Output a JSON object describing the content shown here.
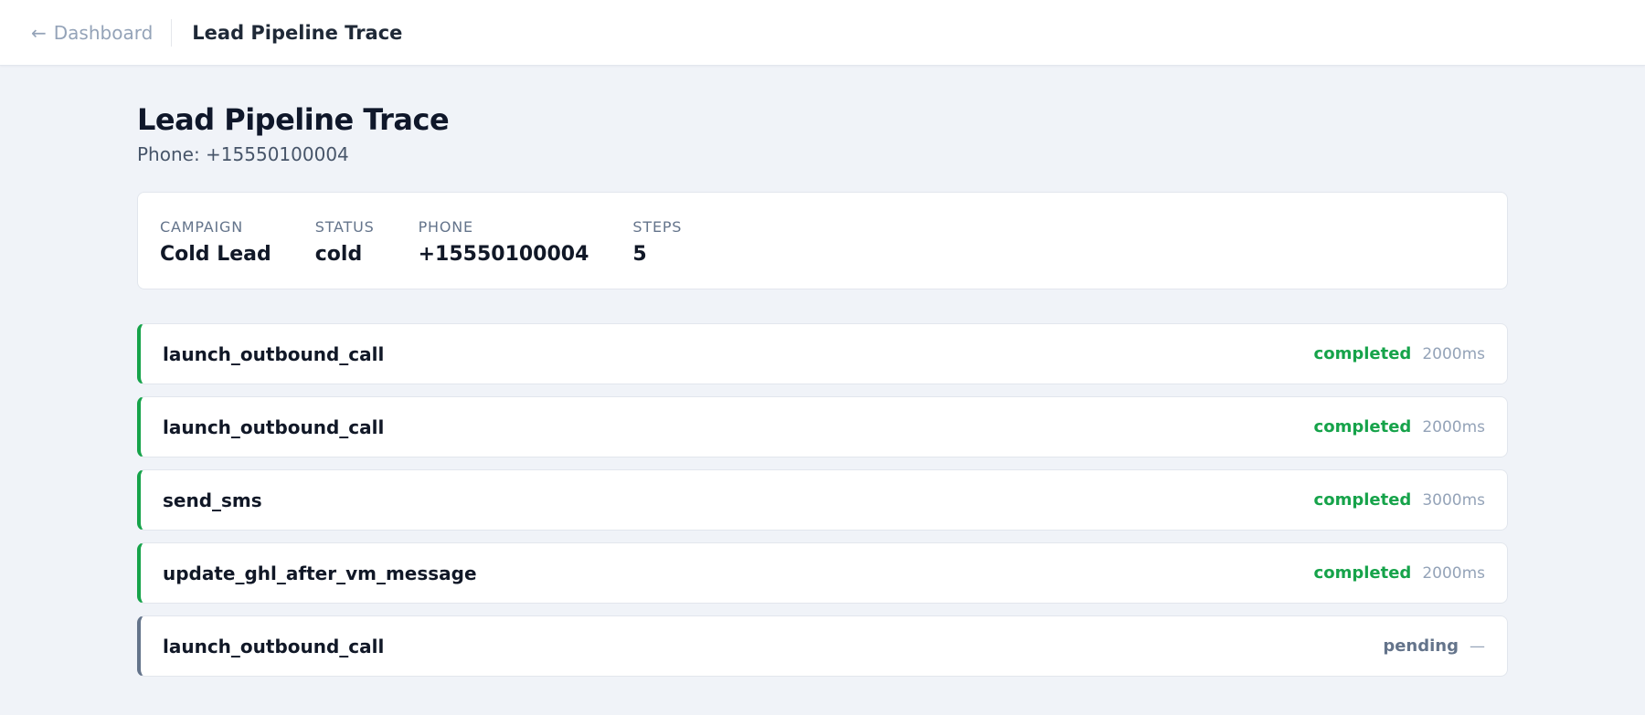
{
  "topbar": {
    "back_icon": "←",
    "back_label": "Dashboard",
    "title": "Lead Pipeline Trace"
  },
  "page": {
    "title": "Lead Pipeline Trace",
    "subtitle": "Phone: +15550100004"
  },
  "summary": {
    "campaign_label": "CAMPAIGN",
    "campaign_value": "Cold Lead",
    "status_label": "STATUS",
    "status_value": "cold",
    "phone_label": "PHONE",
    "phone_value": "+15550100004",
    "steps_label": "STEPS",
    "steps_value": "5"
  },
  "colors": {
    "completed": "#16a34a",
    "pending": "#64748b"
  },
  "steps": [
    {
      "name": "launch_outbound_call",
      "status": "completed",
      "duration": "2000ms"
    },
    {
      "name": "launch_outbound_call",
      "status": "completed",
      "duration": "2000ms"
    },
    {
      "name": "send_sms",
      "status": "completed",
      "duration": "3000ms"
    },
    {
      "name": "update_ghl_after_vm_message",
      "status": "completed",
      "duration": "2000ms"
    },
    {
      "name": "launch_outbound_call",
      "status": "pending",
      "duration": "—"
    }
  ]
}
